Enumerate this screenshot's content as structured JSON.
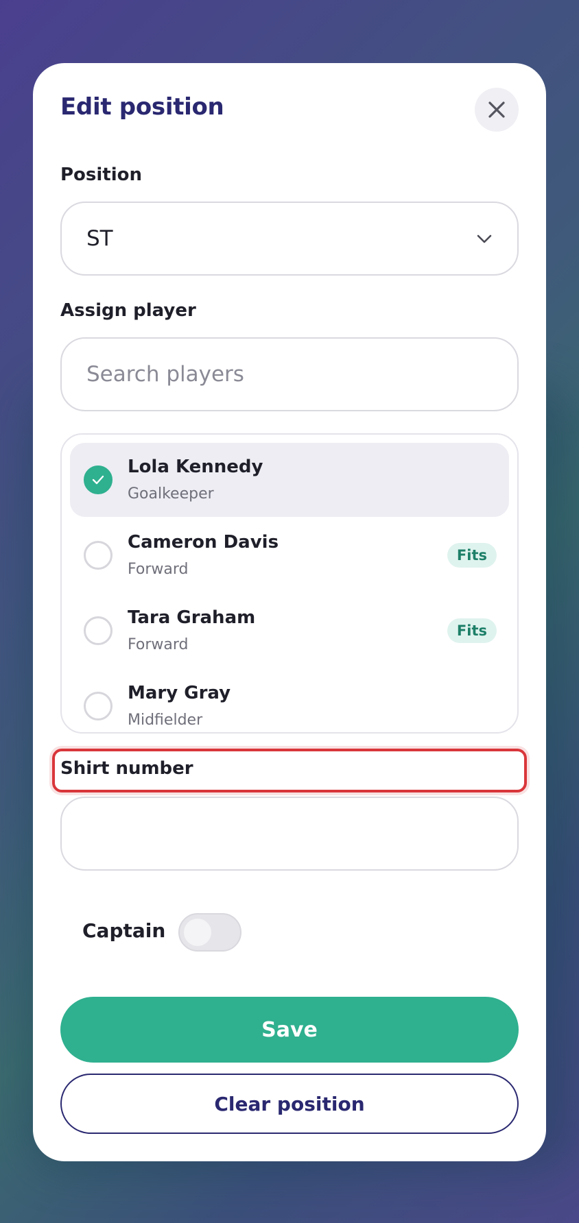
{
  "sheet": {
    "title": "Edit position",
    "close_icon": "close-icon"
  },
  "position": {
    "label": "Position",
    "value": "ST"
  },
  "assign": {
    "label": "Assign player",
    "search_placeholder": "Search players"
  },
  "players": [
    {
      "name": "Lola Kennedy",
      "role": "Goalkeeper",
      "selected": true,
      "badge": ""
    },
    {
      "name": "Cameron Davis",
      "role": "Forward",
      "selected": false,
      "badge": "Fits"
    },
    {
      "name": "Tara Graham",
      "role": "Forward",
      "selected": false,
      "badge": "Fits"
    },
    {
      "name": "Mary Gray",
      "role": "Midfielder",
      "selected": false,
      "badge": ""
    }
  ],
  "shirt": {
    "label": "Shirt number",
    "value": ""
  },
  "captain": {
    "label": "Captain",
    "on": false
  },
  "actions": {
    "save_label": "Save",
    "clear_label": "Clear position"
  },
  "colors": {
    "accent": "#2fb08f",
    "brand": "#2a2870",
    "highlight": "#d9363a"
  }
}
